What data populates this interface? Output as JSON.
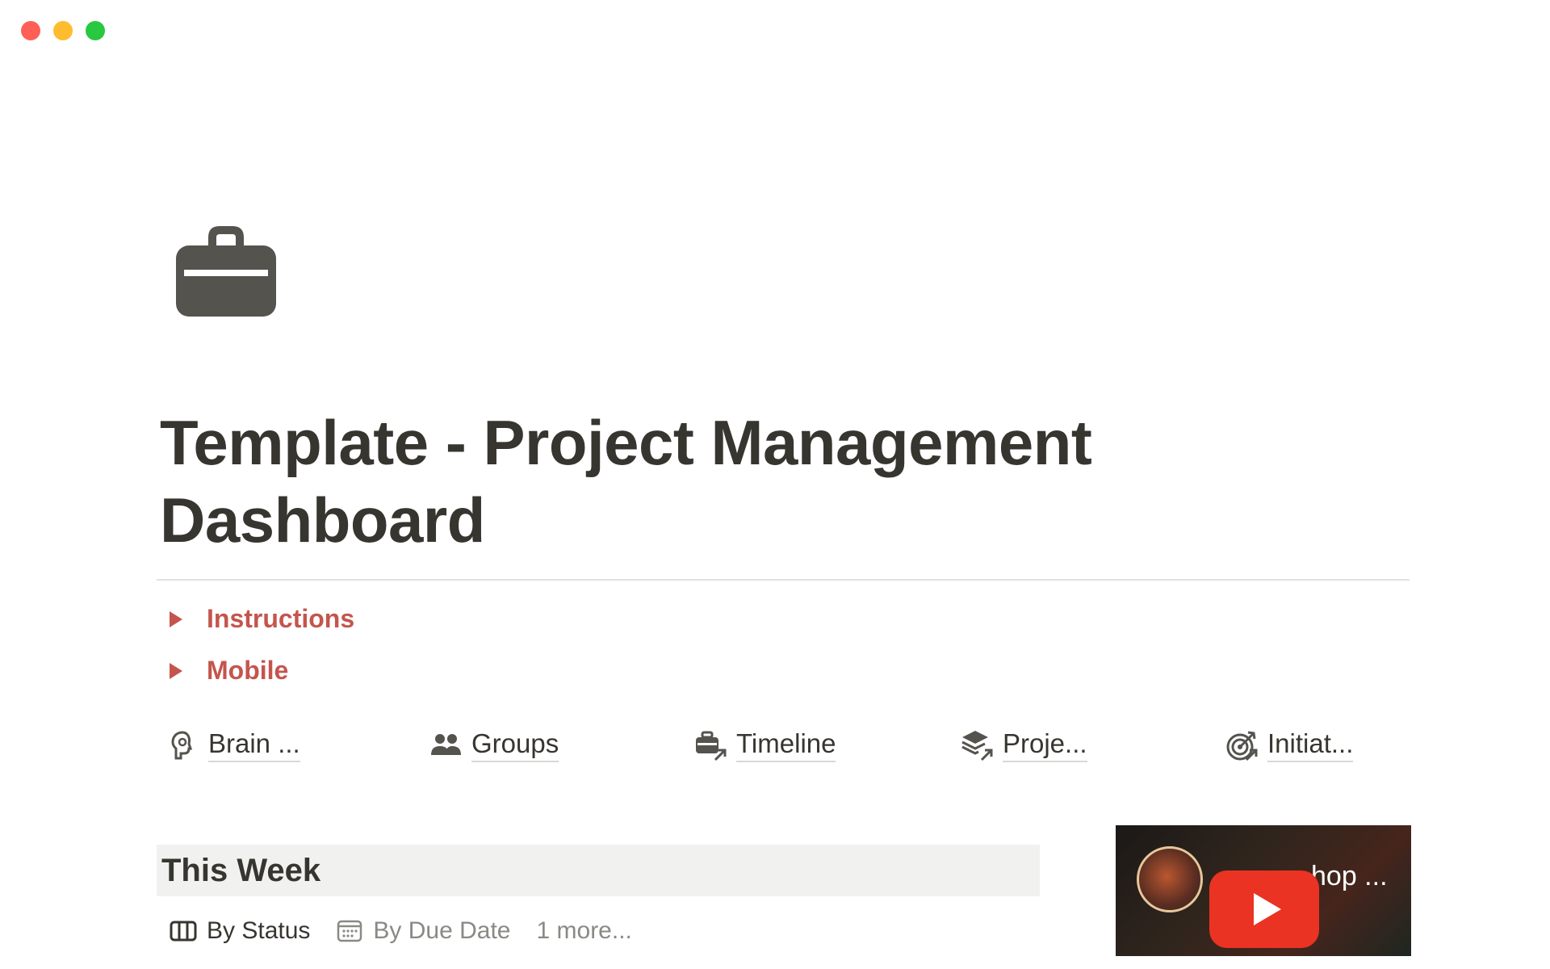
{
  "window": {
    "controls": [
      "close",
      "minimize",
      "maximize"
    ]
  },
  "page": {
    "icon": "briefcase-icon",
    "title": "Template - Project Management Dashboard"
  },
  "toggles": [
    {
      "label": "Instructions",
      "color": "#c4554d"
    },
    {
      "label": "Mobile",
      "color": "#c4554d"
    }
  ],
  "links": [
    {
      "label": "Brain ...",
      "icon": "brain-icon"
    },
    {
      "label": "Groups",
      "icon": "people-icon"
    },
    {
      "label": "Timeline",
      "icon": "briefcase-arrow-icon"
    },
    {
      "label": "Proje...",
      "icon": "layers-arrow-icon"
    },
    {
      "label": "Initiat...",
      "icon": "target-arrow-icon"
    }
  ],
  "this_week": {
    "heading": "This Week",
    "views": [
      {
        "label": "By Status",
        "icon": "board-icon",
        "active": true
      },
      {
        "label": "By Due Date",
        "icon": "calendar-icon",
        "active": false
      }
    ],
    "more_label": "1 more..."
  },
  "video": {
    "title": "l ...",
    "title_visible": "hop ...",
    "play_icon": "youtube-play-icon",
    "brand_color": "#ea3323"
  }
}
